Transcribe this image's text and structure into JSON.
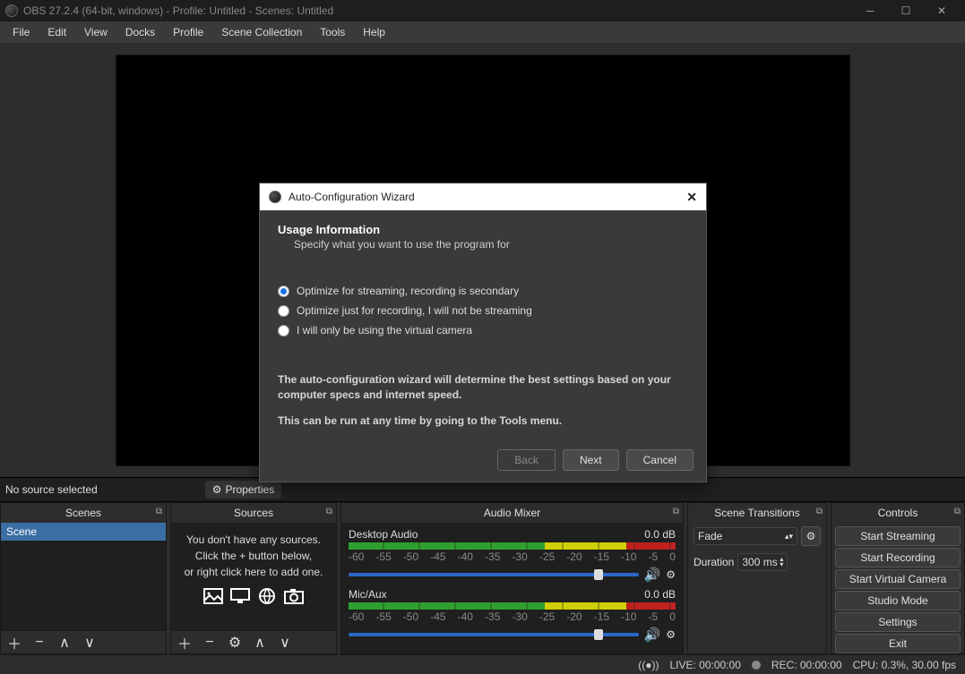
{
  "titlebar": {
    "title": "OBS 27.2.4 (64-bit, windows) - Profile: Untitled - Scenes: Untitled"
  },
  "menubar": [
    "File",
    "Edit",
    "View",
    "Docks",
    "Profile",
    "Scene Collection",
    "Tools",
    "Help"
  ],
  "sourceprops": {
    "no_source": "No source selected",
    "properties": "Properties"
  },
  "docks": {
    "scenes_title": "Scenes",
    "sources_title": "Sources",
    "mixer_title": "Audio Mixer",
    "transitions_title": "Scene Transitions",
    "controls_title": "Controls"
  },
  "scenes": {
    "items": [
      "Scene"
    ]
  },
  "sources": {
    "empty1": "You don't have any sources.",
    "empty2": "Click the + button below,",
    "empty3": "or right click here to add one."
  },
  "mixer": {
    "channels": [
      {
        "name": "Desktop Audio",
        "db": "0.0 dB"
      },
      {
        "name": "Mic/Aux",
        "db": "0.0 dB"
      }
    ],
    "ticks": [
      "-60",
      "-55",
      "-50",
      "-45",
      "-40",
      "-35",
      "-30",
      "-25",
      "-20",
      "-15",
      "-10",
      "-5",
      "0"
    ]
  },
  "transitions": {
    "selected": "Fade",
    "duration_label": "Duration",
    "duration_value": "300 ms"
  },
  "controls": {
    "buttons": [
      "Start Streaming",
      "Start Recording",
      "Start Virtual Camera",
      "Studio Mode",
      "Settings",
      "Exit"
    ]
  },
  "statusbar": {
    "live": "LIVE: 00:00:00",
    "rec": "REC: 00:00:00",
    "cpu": "CPU: 0.3%, 30.00 fps"
  },
  "dialog": {
    "title": "Auto-Configuration Wizard",
    "heading": "Usage Information",
    "subheading": "Specify what you want to use the program for",
    "opt1": "Optimize for streaming, recording is secondary",
    "opt2": "Optimize just for recording, I will not be streaming",
    "opt3": "I will only be using the virtual camera",
    "info1": "The auto-configuration wizard will determine the best settings based on your computer specs and internet speed.",
    "info2": "This can be run at any time by going to the Tools menu.",
    "back": "Back",
    "next": "Next",
    "cancel": "Cancel"
  }
}
